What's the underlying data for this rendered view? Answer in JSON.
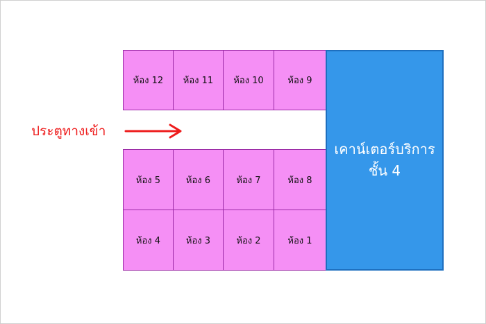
{
  "rooms_top": [
    "ห้อง 12",
    "ห้อง 11",
    "ห้อง 10",
    "ห้อง 9"
  ],
  "rooms_mid": [
    "ห้อง 5",
    "ห้อง 6",
    "ห้อง 7",
    "ห้อง 8"
  ],
  "rooms_bottom": [
    "ห้อง 4",
    "ห้อง 3",
    "ห้อง 2",
    "ห้อง 1"
  ],
  "counter": {
    "line1": "เคาน์เตอร์บริการ",
    "line2": "ชั้น 4"
  },
  "entrance": {
    "label": "ประตูทางเข้า"
  },
  "colors": {
    "room_fill": "#f58ff5",
    "room_border": "#9b2aa6",
    "counter_fill": "#3597ea",
    "entrance_text": "#ee1c1c"
  }
}
